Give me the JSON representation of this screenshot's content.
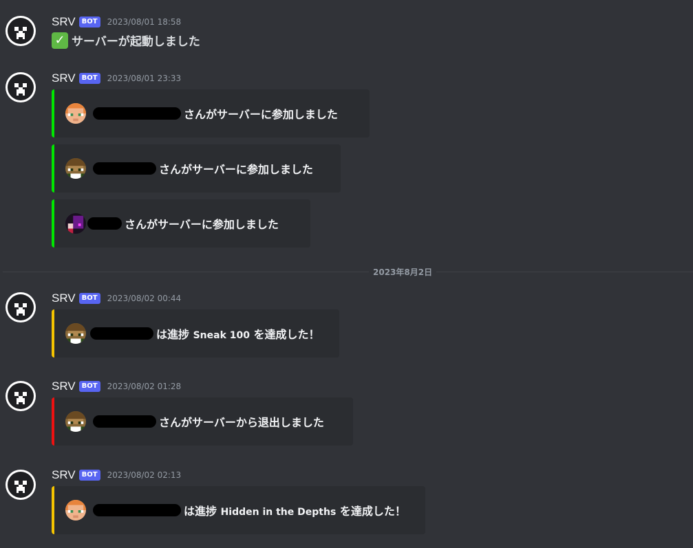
{
  "messages": [
    {
      "username": "SRV",
      "bot_tag": "BOT",
      "timestamp": "2023/08/01 18:58",
      "text": "サーバーが起動しました",
      "icon": "check-mark-icon"
    },
    {
      "username": "SRV",
      "bot_tag": "BOT",
      "timestamp": "2023/08/01 23:33",
      "embeds": [
        {
          "text": "さんがサーバーに参加しました",
          "color": "#00e600",
          "avatar": "steve-head-orange"
        },
        {
          "text": "さんがサーバーに参加しました",
          "color": "#00e600",
          "avatar": "player-head-brown"
        },
        {
          "text": "さんがサーバーに参加しました",
          "color": "#00e600",
          "avatar": "player-head-dark"
        }
      ]
    },
    {
      "username": "SRV",
      "bot_tag": "BOT",
      "timestamp": "2023/08/02 00:44",
      "embeds": [
        {
          "pre": "は進捗 ",
          "advancement": "Sneak 100",
          "post": " を達成した！",
          "color": "#f5c400",
          "avatar": "player-head-brown"
        }
      ]
    },
    {
      "username": "SRV",
      "bot_tag": "BOT",
      "timestamp": "2023/08/02 01:28",
      "embeds": [
        {
          "text": "さんがサーバーから退出しました",
          "color": "#ed1111",
          "avatar": "player-head-brown"
        }
      ]
    },
    {
      "username": "SRV",
      "bot_tag": "BOT",
      "timestamp": "2023/08/02 02:13",
      "embeds": [
        {
          "pre": "は進捗 ",
          "advancement": "Hidden in the Depths",
          "post": " を達成した！",
          "color": "#f5c400",
          "avatar": "steve-head-orange"
        }
      ]
    }
  ],
  "date_divider": "2023年8月2日",
  "colors": {
    "background": "#313338",
    "embed_background": "#2b2d31",
    "bot_tag": "#5865f2",
    "join": "#00e600",
    "advancement": "#f5c400",
    "leave": "#ed1111"
  }
}
